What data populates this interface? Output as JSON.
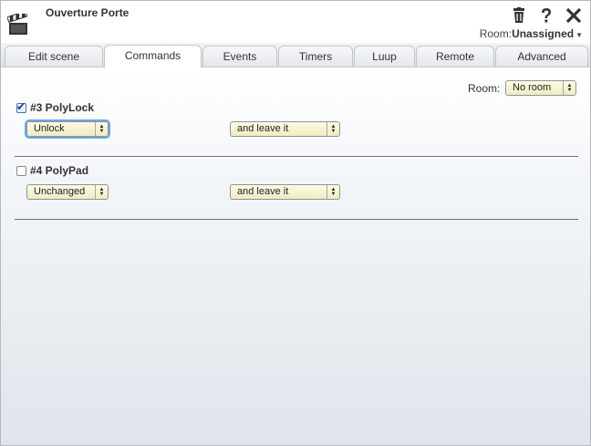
{
  "window": {
    "title": "Ouverture Porte"
  },
  "header": {
    "room_label": "Room:",
    "room_value": "Unassigned",
    "icons": [
      "clapperboard-icon",
      "trash-icon",
      "help-icon",
      "close-icon"
    ]
  },
  "tabs": [
    {
      "label": "Edit scene",
      "active": false
    },
    {
      "label": "Commands",
      "active": true
    },
    {
      "label": "Events",
      "active": false
    },
    {
      "label": "Timers",
      "active": false
    },
    {
      "label": "Luup",
      "active": false
    },
    {
      "label": "Remote",
      "active": false
    },
    {
      "label": "Advanced",
      "active": false
    }
  ],
  "filter": {
    "room_label": "Room:",
    "room_value": "No room"
  },
  "devices": [
    {
      "name": "#3 PolyLock",
      "checked": true,
      "action": "Unlock",
      "mode": "and leave it"
    },
    {
      "name": "#4 PolyPad",
      "checked": false,
      "action": "Unchanged",
      "mode": "and leave it"
    }
  ],
  "colors": {
    "select_bg": "#f0ecc1",
    "focus_ring": "#6fa6e6",
    "tab_active": "#ffffff"
  }
}
